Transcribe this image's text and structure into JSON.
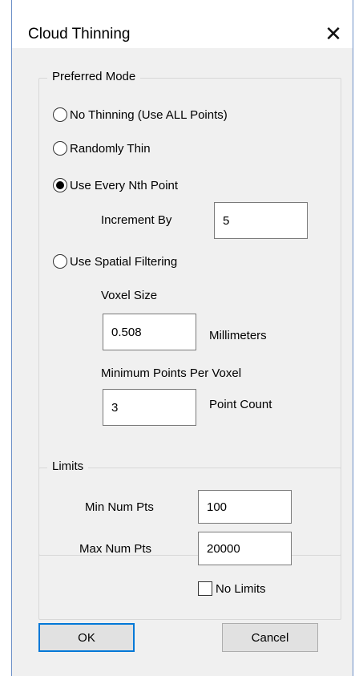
{
  "window": {
    "title": "Cloud Thinning",
    "close_glyph": "✕"
  },
  "preferred_mode": {
    "legend": "Preferred Mode",
    "options": [
      {
        "label": "No Thinning (Use ALL Points)",
        "selected": false
      },
      {
        "label": "Randomly Thin",
        "selected": false
      },
      {
        "label": "Use Every Nth Point",
        "selected": true
      },
      {
        "label": "Use Spatial Filtering",
        "selected": false
      }
    ],
    "increment_label": "Increment By",
    "increment_value": "5",
    "voxel_size_label": "Voxel Size",
    "voxel_size_value": "0.508",
    "voxel_unit": "Millimeters",
    "min_points_label": "Minimum Points Per Voxel",
    "min_points_value": "3",
    "min_points_unit": "Point Count"
  },
  "limits": {
    "legend": "Limits",
    "min_label": "Min Num Pts",
    "min_value": "100",
    "max_label": "Max Num Pts",
    "max_value": "20000",
    "no_limits_label": "No Limits",
    "no_limits_checked": false
  },
  "buttons": {
    "ok": "OK",
    "cancel": "Cancel"
  },
  "colors": {
    "accent": "#0078d7",
    "window_border": "#6c8fc7"
  }
}
